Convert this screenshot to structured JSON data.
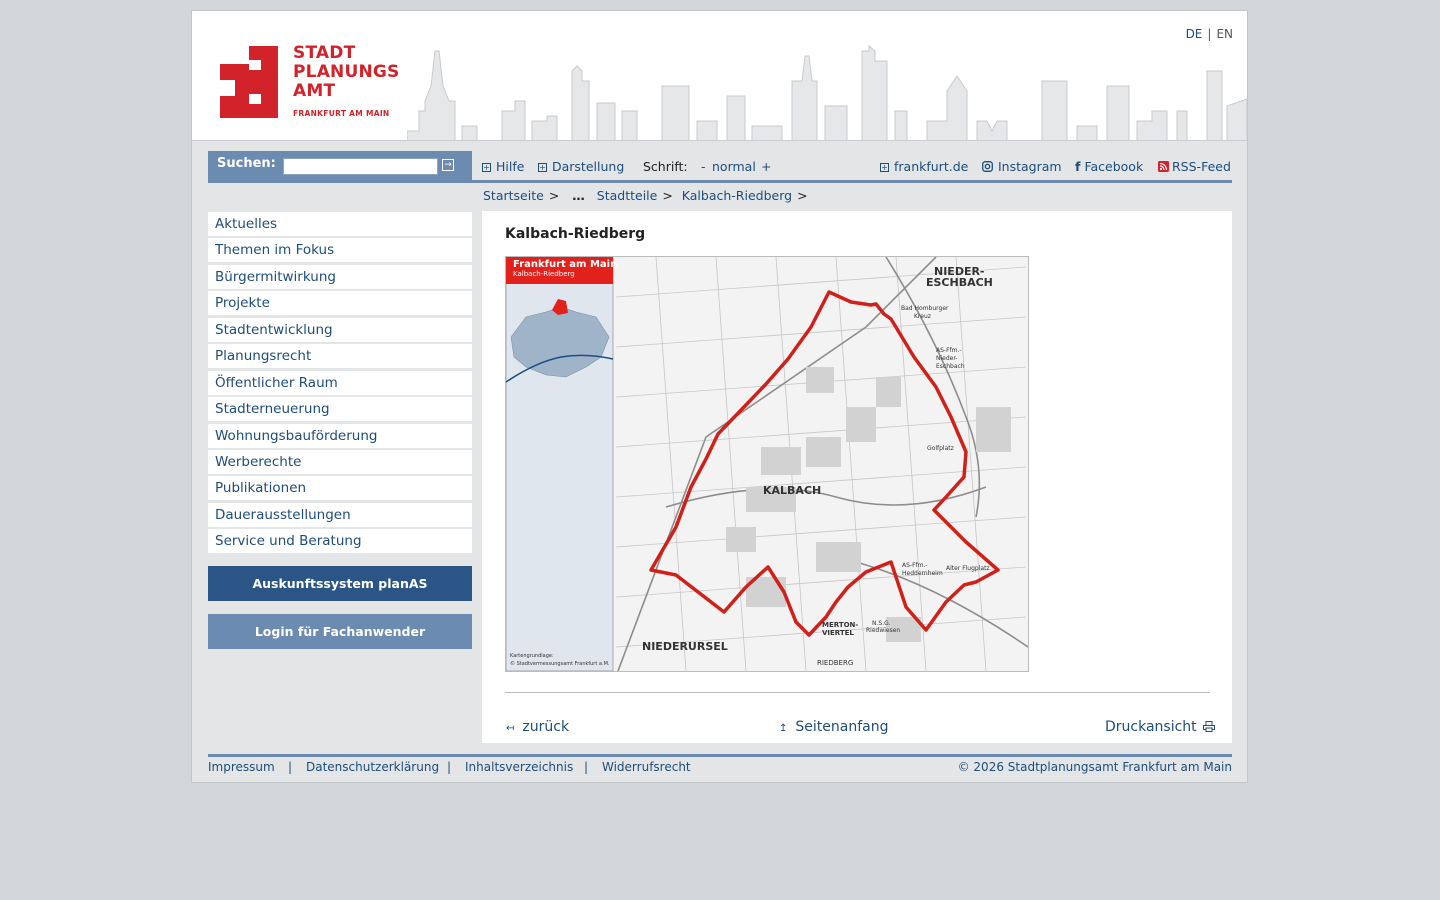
{
  "header": {
    "logo_lines": [
      "STADT",
      "PLANUNGS",
      "AMT"
    ],
    "logo_sub": "FRANKFURT AM MAIN",
    "lang": [
      "DE",
      "EN"
    ]
  },
  "search": {
    "label": "Suchen:",
    "value": ""
  },
  "toolbar": {
    "help": "Hilfe",
    "display": "Darstellung",
    "font_label": "Schrift:",
    "font_minus": "-",
    "font_normal": "normal",
    "font_plus": "+",
    "frankfurt": "frankfurt.de",
    "instagram": "Instagram",
    "facebook": "Facebook",
    "rss": "RSS-Feed"
  },
  "breadcrumb": [
    "Startseite",
    "…",
    "Stadtteile",
    "Kalbach-Riedberg"
  ],
  "sidebar": [
    "Aktuelles",
    "Themen im Fokus",
    "Bürgermitwirkung",
    "Projekte",
    "Stadtentwicklung",
    "Planungsrecht",
    "Öffentlicher Raum",
    "Stadterneuerung",
    "Wohnungsbauförderung",
    "Werberechte",
    "Publikationen",
    "Dauerausstellungen",
    "Service und Beratung"
  ],
  "buttons": {
    "planas": "Auskunftssystem planAS",
    "login": "Login für Fachanwender"
  },
  "content": {
    "title": "Kalbach-Riedberg",
    "map": {
      "inset_title": "Frankfurt am Main",
      "inset_sub": "Kalbach-Riedberg",
      "labels": [
        "NIEDER-",
        "ESCHBACH",
        "KALBACH",
        "NIEDERURSEL",
        "MERTON-",
        "VIERTEL",
        "RIEDBERG",
        "Bad Homburger",
        "Kreuz",
        "AS-Ffm.-",
        "Nieder-",
        "Eschbach",
        "AS-Ffm.-",
        "Heddernheim",
        "Golfplatz",
        "Alter Flugplatz",
        "N.S.G.",
        "Riedwiesen",
        "Kartengrundlage:",
        "© Stadtvermessungsamt Frankfurt a.M."
      ]
    },
    "back": "zurück",
    "top": "Seitenanfang",
    "print": "Druckansicht"
  },
  "footer": {
    "links": [
      "Impressum",
      "Datenschutzerklärung",
      "Inhaltsverzeichnis",
      "Widerrufsrecht"
    ],
    "copyright": "© 2026 Stadtplanungsamt Frankfurt am Main"
  },
  "colors": {
    "brand_red": "#d2232a",
    "nav_blue": "#6b8bb0",
    "link_blue": "#1e4d7b",
    "button_dark": "#2a5585"
  }
}
